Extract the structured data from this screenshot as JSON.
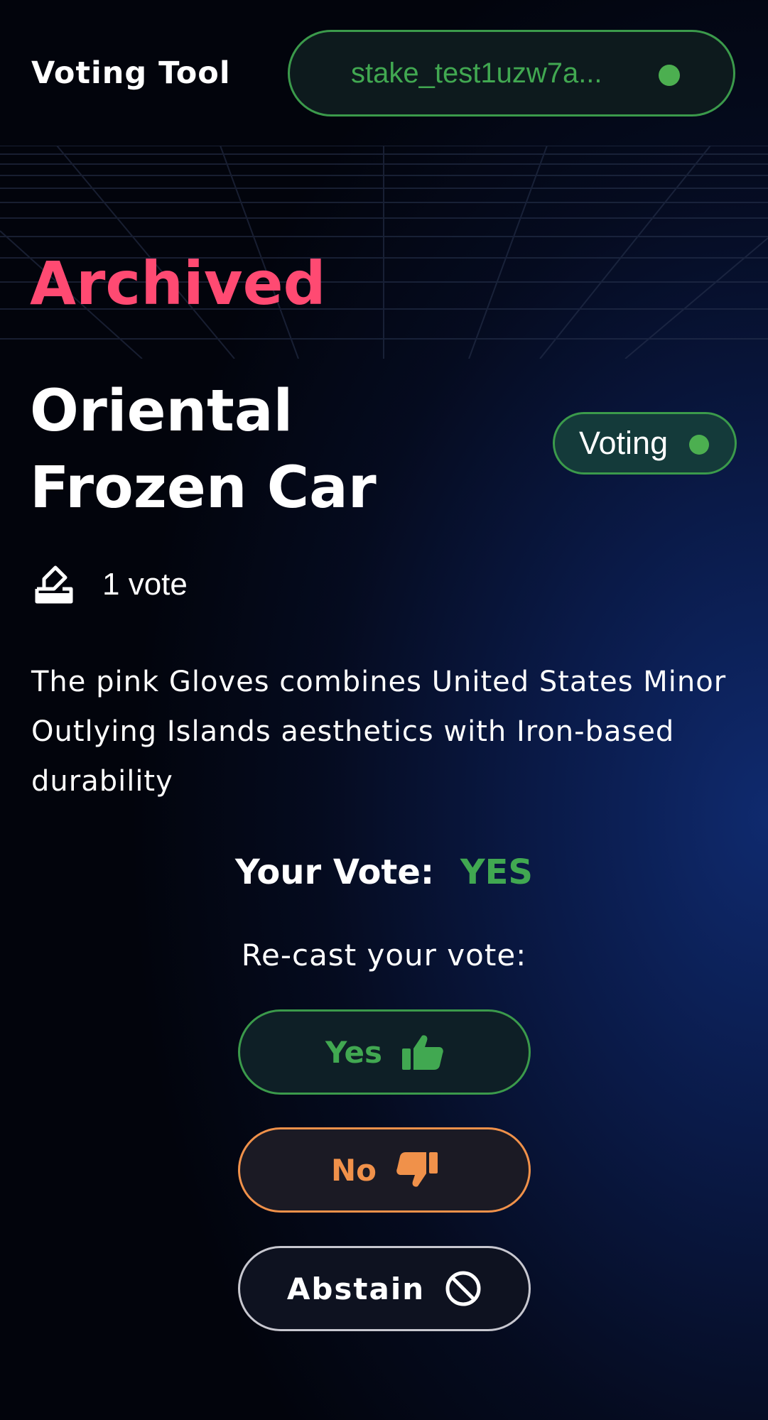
{
  "header": {
    "app_title": "Voting Tool",
    "wallet_address": "stake_test1uzw7a...",
    "wallet_status_color": "#4caf50"
  },
  "proposal": {
    "state": "Archived",
    "title": "Oriental Frozen Car",
    "status_label": "Voting",
    "vote_count": "1 vote",
    "description": "The pink Gloves combines United States Minor Outlying Islands aesthetics with Iron-based durability"
  },
  "vote": {
    "your_vote_label": "Your Vote:",
    "your_vote_value": "YES",
    "recast_label": "Re-cast your vote:",
    "buttons": {
      "yes": "Yes",
      "no": "No",
      "abstain": "Abstain"
    }
  },
  "icons": {
    "ballot": "ballot-box-icon",
    "yes": "thumbs-up-icon",
    "no": "thumbs-down-icon",
    "abstain": "ban-icon"
  },
  "colors": {
    "accent_green": "#41a851",
    "archived_pink": "#ff4a72",
    "no_orange": "#f0914a"
  }
}
